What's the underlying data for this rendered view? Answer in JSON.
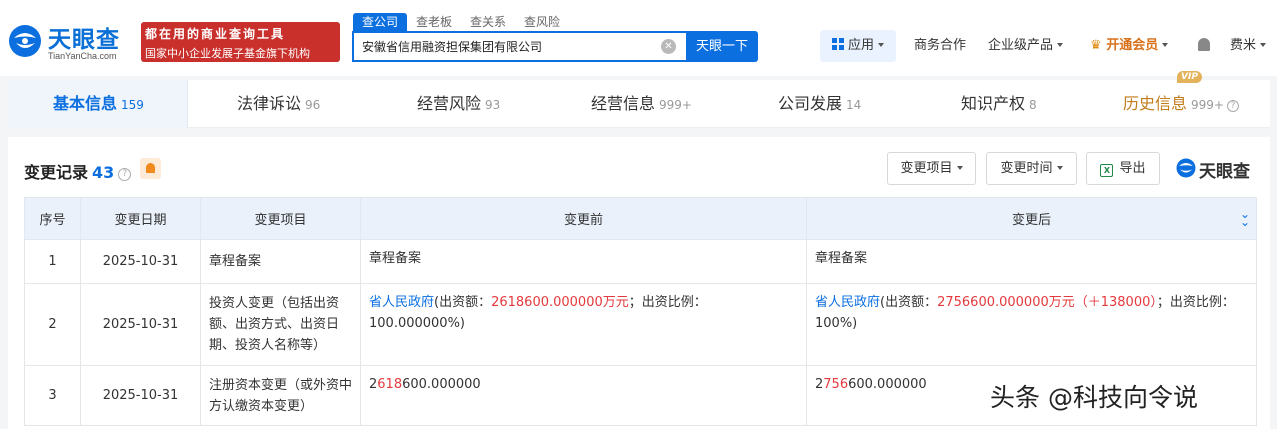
{
  "brand": {
    "name": "天眼查",
    "domain": "TianYanCha.com",
    "color": "#0b6fe0"
  },
  "banner": {
    "line1": "都在用的商业查询工具",
    "line2": "国家中小企业发展子基金旗下机构"
  },
  "search": {
    "tabs": [
      "查公司",
      "查老板",
      "查关系",
      "查风险"
    ],
    "value": "安徽省信用融资担保集团有限公司",
    "button": "天眼一下"
  },
  "nav": {
    "apps": "应用",
    "business": "商务合作",
    "enterprise": "企业级产品",
    "vip": "开通会员",
    "user": "费米"
  },
  "tabs": [
    {
      "label": "基本信息",
      "count": "159"
    },
    {
      "label": "法律诉讼",
      "count": "96"
    },
    {
      "label": "经营风险",
      "count": "93"
    },
    {
      "label": "经营信息",
      "count": "999+"
    },
    {
      "label": "公司发展",
      "count": "14"
    },
    {
      "label": "知识产权",
      "count": "8"
    },
    {
      "label": "历史信息",
      "count": "999+",
      "badge": "VIP"
    }
  ],
  "section": {
    "title": "变更记录",
    "count": "43",
    "filter1": "变更项目",
    "filter2": "变更时间",
    "export": "导出",
    "brand": "天眼查"
  },
  "table": {
    "headers": [
      "序号",
      "变更日期",
      "变更项目",
      "变更前",
      "变更后"
    ],
    "rows": [
      {
        "no": "1",
        "date": "2025-10-31",
        "item": "章程备案",
        "before": "章程备案",
        "after": "章程备案"
      },
      {
        "no": "2",
        "date": "2025-10-31",
        "item": "投资人变更（包括出资额、出资方式、出资日期、投资人名称等）",
        "before_link": "省人民政府",
        "before_pre": "(出资额：",
        "before_amount": "2618600.000000万元",
        "before_post": "；出资比例：100.000000%)",
        "after_link": "省人民政府",
        "after_pre": "(出资额：",
        "after_amount": "2756600.000000万元（＋138000）",
        "after_post": "；出资比例：100%)"
      },
      {
        "no": "3",
        "date": "2025-10-31",
        "item": "注册资本变更（或外资中方认缴资本变更）",
        "before_a": "2",
        "before_b": "618",
        "before_c": "600.000000",
        "after_a": "2",
        "after_b": "756",
        "after_c": "600.000000"
      }
    ]
  },
  "watermark": "头条 @科技向令说"
}
